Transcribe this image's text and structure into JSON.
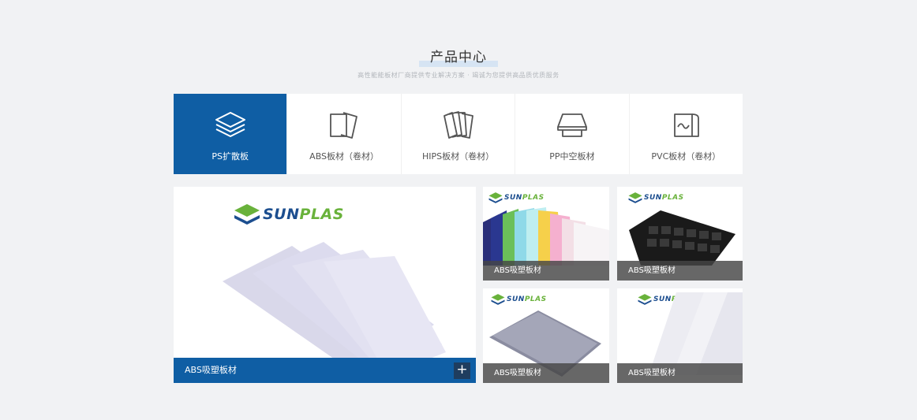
{
  "section": {
    "title": "产品中心",
    "subtitle": "高性能能板材厂商提供专业解决方案 · 竭诚为您提供高品质优质服务"
  },
  "tabs": [
    {
      "label": "PS扩散板",
      "icon": "layers-icon",
      "active": true
    },
    {
      "label": "ABS板材（卷材）",
      "icon": "sheets-icon",
      "active": false
    },
    {
      "label": "HIPS板材（卷材）",
      "icon": "stacked-sheets-icon",
      "active": false
    },
    {
      "label": "PP中空板材",
      "icon": "tray-icon",
      "active": false
    },
    {
      "label": "PVC板材（卷材）",
      "icon": "roll-icon",
      "active": false
    }
  ],
  "brand": {
    "name_part1": "SUN",
    "name_part2": "PLAS"
  },
  "products": {
    "featured": {
      "caption": "ABS吸塑板材",
      "more": "+"
    },
    "items": [
      {
        "caption": "ABS吸塑板材"
      },
      {
        "caption": "ABS吸塑板材"
      },
      {
        "caption": "ABS吸塑板材"
      },
      {
        "caption": "ABS吸塑板材"
      }
    ]
  },
  "colors": {
    "accent": "#0f5ea4",
    "background": "#f1f2f4"
  }
}
